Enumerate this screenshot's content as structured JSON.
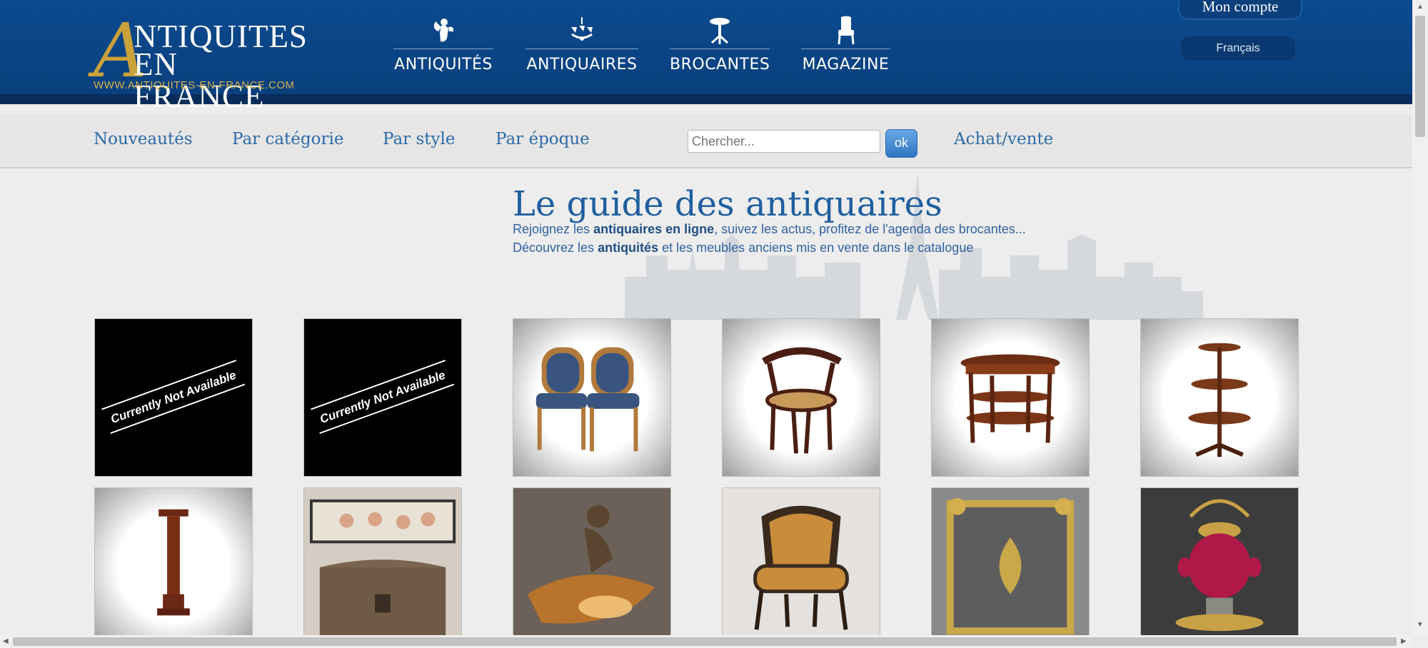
{
  "logo": {
    "initial": "A",
    "line1": "NTIQUITES",
    "line2": "EN FRANCE",
    "url": "WWW.ANTIQUITES-EN-FRANCE.COM"
  },
  "main_nav": [
    {
      "label": "ANTIQUITÉS",
      "icon": "angel-icon"
    },
    {
      "label": "ANTIQUAIRES",
      "icon": "chandelier-icon"
    },
    {
      "label": "BROCANTES",
      "icon": "gueridon-table-icon"
    },
    {
      "label": "MAGAZINE",
      "icon": "armchair-icon"
    }
  ],
  "account": {
    "label": "Mon compte"
  },
  "language": {
    "label": "Français"
  },
  "sub_nav": {
    "nouveautes": "Nouveautés",
    "par_categorie": "Par catégorie",
    "par_style": "Par style",
    "par_epoque": "Par époque",
    "achat_vente": "Achat/vente"
  },
  "search": {
    "placeholder": "Chercher...",
    "button_label": "ok"
  },
  "hero": {
    "title": "Le guide des antiquaires",
    "line1": {
      "pre": "Rejoignez les ",
      "bold": "antiquaires en ligne",
      "post": ", suivez les actus, profitez de l'agenda des brocantes..."
    },
    "line2": {
      "pre": "Découvrez les ",
      "bold": "antiquités",
      "post": " et les meubles anciens mis en vente dans le catalogue"
    }
  },
  "products": [
    {
      "name": "unavailable-image",
      "overlay": "Currently Not Available"
    },
    {
      "name": "unavailable-image",
      "overlay": "Currently Not Available"
    },
    {
      "name": "pair-of-chairs"
    },
    {
      "name": "cane-bentwood-armchair"
    },
    {
      "name": "oval-three-tier-table"
    },
    {
      "name": "pedestal-dumbwaiter"
    },
    {
      "name": "marquetry-column"
    },
    {
      "name": "chest-with-cherubs-painting"
    },
    {
      "name": "bronze-cherub-lamp"
    },
    {
      "name": "leather-bergere-armchair"
    },
    {
      "name": "gilt-fire-screen"
    },
    {
      "name": "pink-glass-tea-urn"
    }
  ],
  "colors": {
    "header_blue": "#0b4a8e",
    "gold": "#c9a23a",
    "link_blue": "#2d6aa8"
  }
}
